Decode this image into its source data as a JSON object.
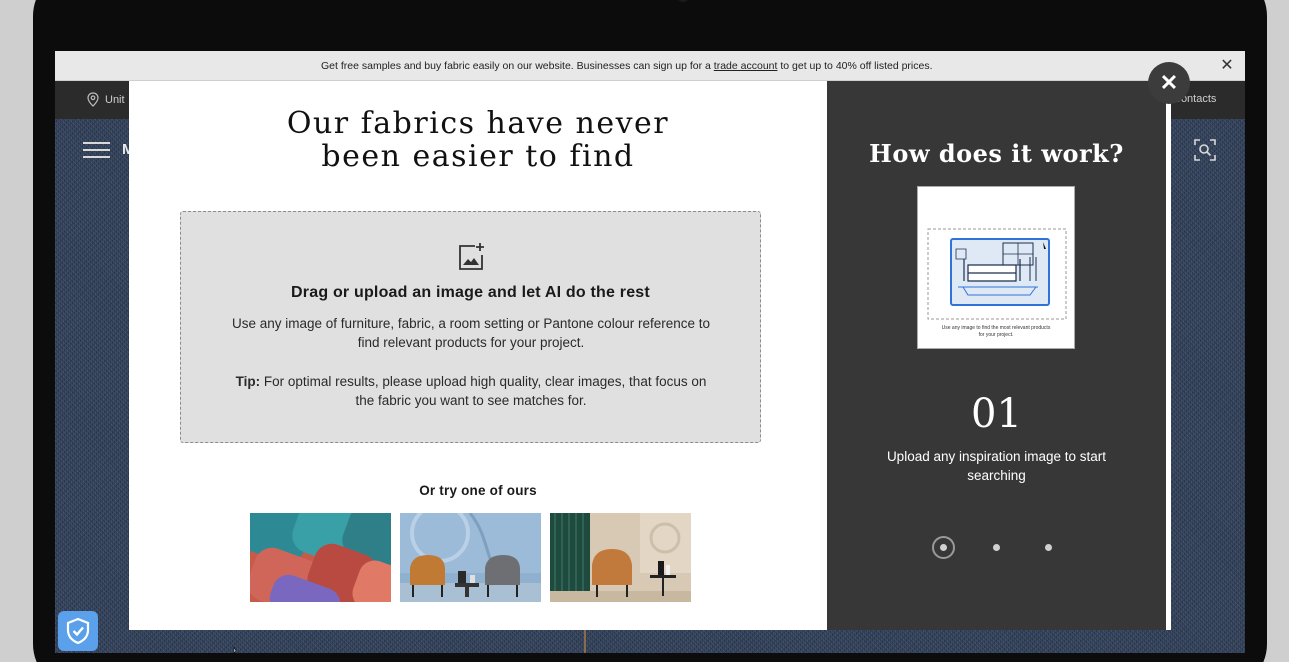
{
  "announcement": {
    "text_before": "Get free samples and buy fabric easily on our website. Businesses can sign up for a ",
    "link": "trade account",
    "text_after": " to get up to 40% off listed prices."
  },
  "topbar": {
    "location": "Unit",
    "contacts": "Contacts"
  },
  "menu": {
    "label": "M"
  },
  "modal": {
    "title_line1": "Our fabrics have never",
    "title_line2": "been easier to find",
    "dropzone": {
      "heading": "Drag or upload an image and let AI do the rest",
      "description": "Use any image of furniture, fabric, a room setting or Pantone colour reference to find relevant products for your project.",
      "tip_label": "Tip:",
      "tip_text": " For optimal results, please upload high quality, clear images, that focus on the fabric you want to see matches for."
    },
    "try_label": "Or try one of ours",
    "close": "✕",
    "how": {
      "title": "How does it work?",
      "illustration_caption_line1": "Use any image to find the most relevant products",
      "illustration_caption_line2": "for your project.",
      "step_number": "01",
      "step_text": "Upload any inspiration image to start searching",
      "steps_total": 3,
      "active_step": 1
    }
  },
  "colors": {
    "modal_right_bg": "#373737",
    "dropzone_bg": "#e0e0e0",
    "topbar_bg": "#2b2b2b",
    "shield_blue": "#5aa0ea"
  }
}
